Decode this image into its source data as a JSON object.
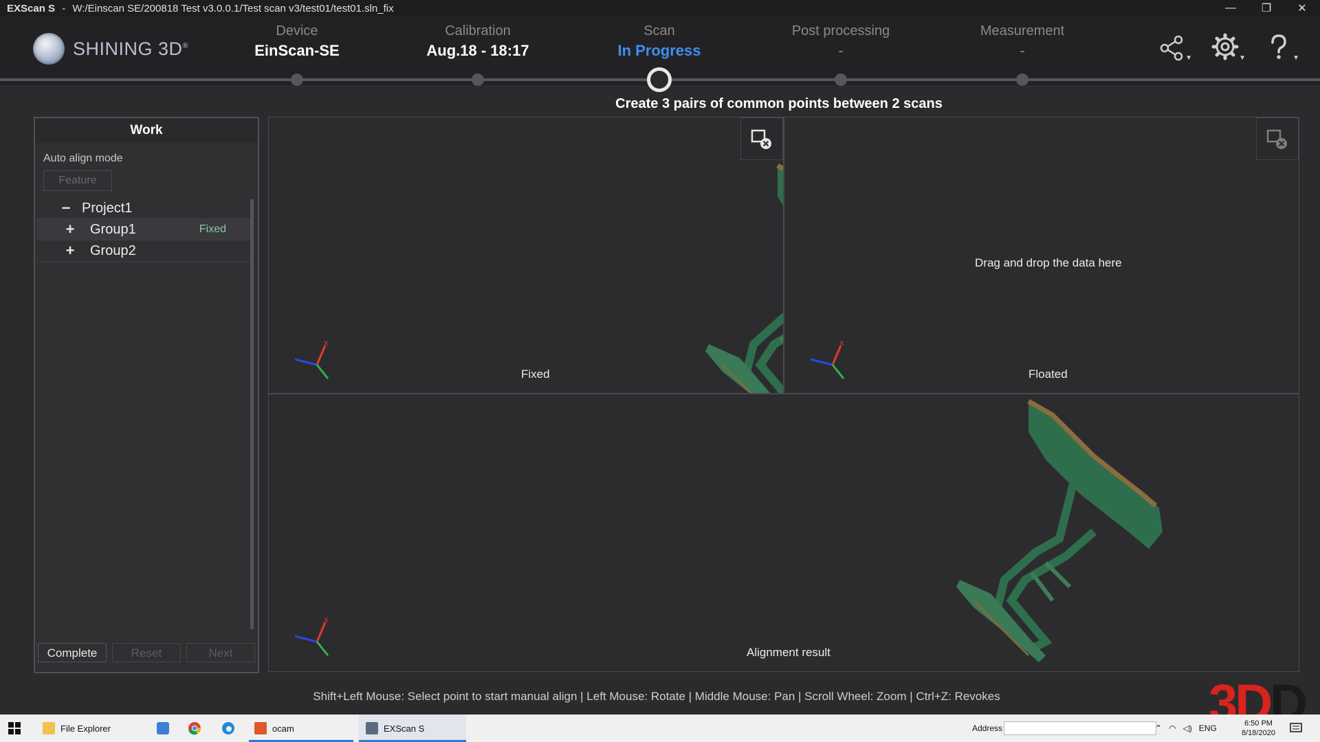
{
  "window": {
    "app_name": "EXScan S",
    "separator": "-",
    "path": "W:/Einscan SE/200818 Test v3.0.0.1/Test scan v3/test01/test01.sln_fix",
    "minimize": "—",
    "restore": "❐",
    "close": "✕"
  },
  "brand": {
    "name": "SHINING 3D",
    "reg": "®"
  },
  "steps": [
    {
      "label": "Device",
      "value": "EinScan-SE"
    },
    {
      "label": "Calibration",
      "value": "Aug.18 - 18:17"
    },
    {
      "label": "Scan",
      "value": "In Progress"
    },
    {
      "label": "Post processing",
      "value": "-"
    },
    {
      "label": "Measurement",
      "value": "-"
    }
  ],
  "instruction": "Create 3 pairs of common points between 2 scans",
  "work_panel": {
    "title": "Work",
    "mode_label": "Auto align mode",
    "mode_button": "Feature",
    "tree": [
      {
        "toggle": "−",
        "name": "Project1",
        "status": ""
      },
      {
        "toggle": "+",
        "name": "Group1",
        "status": "Fixed"
      },
      {
        "toggle": "+",
        "name": "Group2",
        "status": ""
      }
    ],
    "buttons": {
      "complete": "Complete",
      "reset": "Reset",
      "next": "Next"
    }
  },
  "viewports": {
    "fixed_label": "Fixed",
    "floated_label": "Floated",
    "floated_hint": "Drag and drop the data here",
    "result_label": "Alignment result",
    "axis_x": "X"
  },
  "footer_hint": "Shift+Left Mouse: Select point to start manual align | Left Mouse: Rotate | Middle Mouse: Pan | Scroll Wheel: Zoom | Ctrl+Z: Revokes",
  "watermark": {
    "red": "3D",
    "dark": "D"
  },
  "taskbar": {
    "apps": [
      {
        "name": "File Explorer"
      },
      {
        "name": "ocam"
      },
      {
        "name": "EXScan S"
      }
    ],
    "address_label": "Address",
    "tray_lang": "ENG",
    "clock_time": "6:50 PM",
    "clock_date": "8/18/2020"
  },
  "colors": {
    "accent_blue": "#3d8ff0",
    "status_green": "#8fc7a0",
    "model_green": "#2f6e4c",
    "model_tan": "#8a6d3e",
    "watermark_red": "#d9231f"
  }
}
